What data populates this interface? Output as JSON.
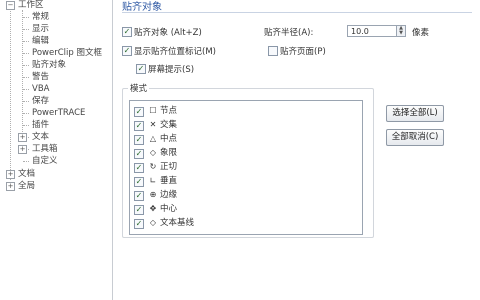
{
  "tree": {
    "workspace_label": "工作区",
    "workspace_children": [
      "常规",
      "显示",
      "编辑",
      "PowerClip 图文框",
      "贴齐对象",
      "警告",
      "VBA",
      "保存",
      "PowerTRACE",
      "插件",
      "文本",
      "工具箱",
      "自定义"
    ],
    "document_label": "文档",
    "global_label": "全局"
  },
  "panel": {
    "title": "贴齐对象",
    "snap_objects_label": "贴齐对象 (Alt+Z)",
    "snap_objects_checked": true,
    "show_snap_location_label": "显示贴齐位置标记(M)",
    "show_snap_location_checked": true,
    "screen_tips_label": "屏幕提示(S)",
    "screen_tips_checked": true,
    "snap_radius_label": "贴齐半径(A):",
    "snap_radius_value": "10.0",
    "snap_radius_unit": "像素",
    "snap_page_label": "贴齐页面(P)",
    "snap_page_checked": false
  },
  "modes": {
    "group_label": "模式",
    "items": [
      {
        "icon": "☐",
        "label": "节点",
        "checked": true
      },
      {
        "icon": "✕",
        "label": "交集",
        "checked": true
      },
      {
        "icon": "△",
        "label": "中点",
        "checked": true
      },
      {
        "icon": "◇",
        "label": "象限",
        "checked": true
      },
      {
        "icon": "↻",
        "label": "正切",
        "checked": true
      },
      {
        "icon": "∟",
        "label": "垂直",
        "checked": true
      },
      {
        "icon": "⊕",
        "label": "边缘",
        "checked": true
      },
      {
        "icon": "✥",
        "label": "中心",
        "checked": true
      },
      {
        "icon": "◇",
        "label": "文本基线",
        "checked": true
      }
    ],
    "select_all_label": "选择全部(L)",
    "cancel_all_label": "全部取消(C)"
  }
}
